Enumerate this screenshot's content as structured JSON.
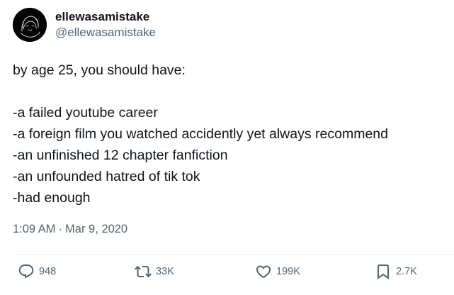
{
  "author": {
    "display_name": "ellewasamistake",
    "handle": "@ellewasamistake",
    "avatar_icon": "sketch-portrait-avatar"
  },
  "tweet": {
    "lines": [
      "by age 25, you should have:",
      "",
      "-a failed youtube career",
      "-a foreign film you watched accidently yet always recommend",
      "-an unfinished 12 chapter fanfiction",
      "-an unfounded hatred of tik tok",
      "-had enough"
    ],
    "time": "1:09 AM",
    "separator": "·",
    "date": "Mar 9, 2020"
  },
  "actions": {
    "replies": {
      "icon": "reply-bubble-icon",
      "count": "948"
    },
    "retweets": {
      "icon": "retweet-icon",
      "count": "33K"
    },
    "likes": {
      "icon": "heart-icon",
      "count": "199K"
    },
    "bookmarks": {
      "icon": "bookmark-icon",
      "count": "2.7K"
    }
  },
  "colors": {
    "text": "#0f1419",
    "secondary": "#536471",
    "divider": "#eff3f4"
  }
}
